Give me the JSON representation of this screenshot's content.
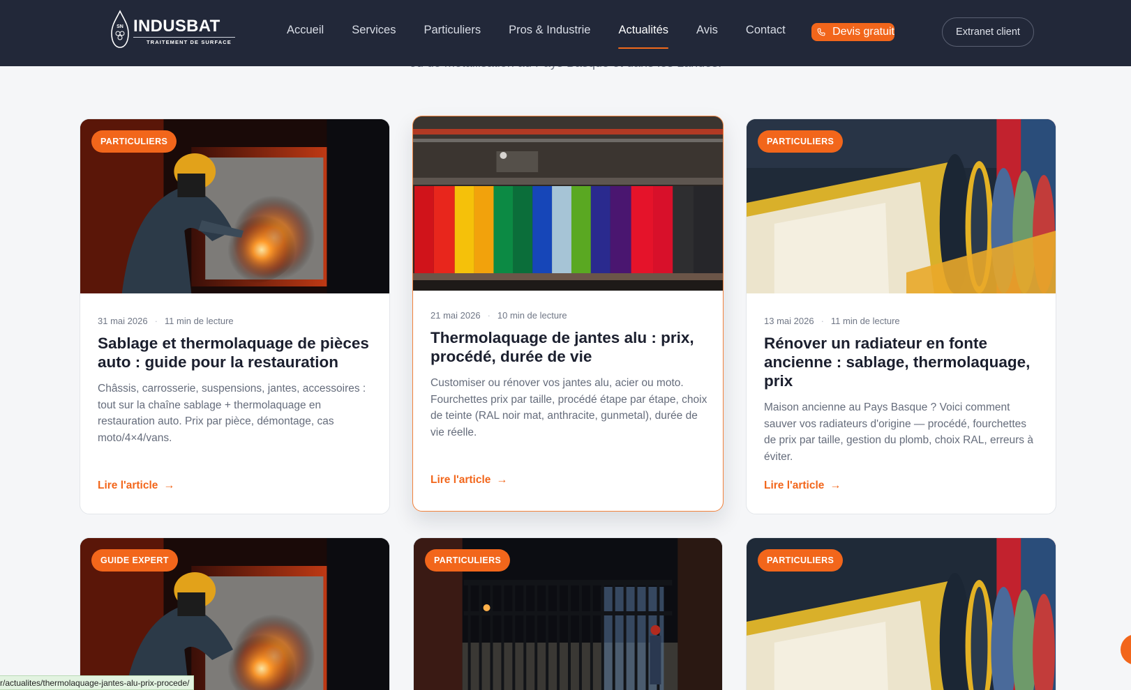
{
  "header": {
    "logo": {
      "name": "INDUSBAT",
      "tagline": "TRAITEMENT DE SURFACE",
      "badge": "SN"
    },
    "nav": [
      {
        "label": "Accueil"
      },
      {
        "label": "Services"
      },
      {
        "label": "Particuliers"
      },
      {
        "label": "Pros & Industrie"
      },
      {
        "label": "Actualités",
        "active": true
      },
      {
        "label": "Avis"
      },
      {
        "label": "Contact"
      }
    ],
    "cta_label": "Devis gratuit",
    "extranet_label": "Extranet client"
  },
  "intro_text": "ou de métallisation au Pays Basque et dans les Landes.",
  "cards": [
    {
      "badge": "PARTICULIERS",
      "date": "31 mai 2026",
      "read_time": "11 min de lecture",
      "title": "Sablage et thermolaquage de pièces auto : guide pour la restauration",
      "description": "Châssis, carrosserie, suspensions, jantes, accessoires : tout sur la chaîne sablage + thermolaquage en restauration auto. Prix par pièce, démontage, cas moto/4×4/vans.",
      "link": "Lire l'article",
      "image": "welder-sparks"
    },
    {
      "badge": "",
      "date": "21 mai 2026",
      "read_time": "10 min de lecture",
      "title": "Thermolaquage de jantes alu : prix, procédé, durée de vie",
      "description": "Customiser ou rénover vos jantes alu, acier ou moto. Fourchettes prix par taille, procédé étape par étape, choix de teinte (RAL noir mat, anthracite, gunmetal), durée de vie réelle.",
      "link": "Lire l'article",
      "image": "color-panels"
    },
    {
      "badge": "PARTICULIERS",
      "date": "13 mai 2026",
      "read_time": "11 min de lecture",
      "title": "Rénover un radiateur en fonte ancienne : sablage, thermolaquage, prix",
      "description": "Maison ancienne au Pays Basque ? Voici comment sauver vos radiateurs d'origine — procédé, fourchettes de prix par taille, gestion du plomb, choix RAL, erreurs à éviter.",
      "link": "Lire l'article",
      "image": "coated-profiles"
    },
    {
      "badge": "GUIDE EXPERT",
      "image": "welder-sparks"
    },
    {
      "badge": "PARTICULIERS",
      "image": "gate-night"
    },
    {
      "badge": "PARTICULIERS",
      "image": "coated-profiles"
    }
  ],
  "status_url": "r/actualites/thermolaquage-jantes-alu-prix-procede/",
  "colors": {
    "header_bg": "#222839",
    "accent": "#f2661b",
    "page_bg": "#f5f6f8"
  }
}
